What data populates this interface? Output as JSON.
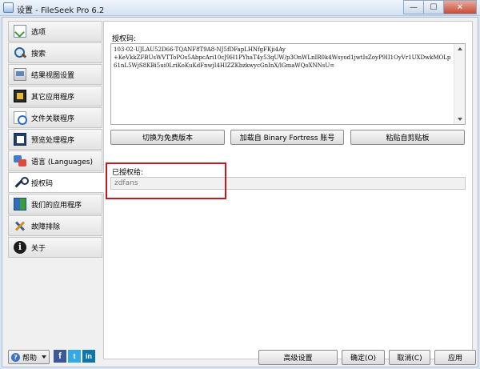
{
  "window": {
    "title": "设置 - FileSeek Pro 6.2",
    "min_glyph": "—",
    "max_glyph": "☐",
    "close_glyph": "✕"
  },
  "sidebar": {
    "items": [
      {
        "label": "选项",
        "icon": "options-icon",
        "active": false
      },
      {
        "label": "搜索",
        "icon": "search-icon",
        "active": false
      },
      {
        "label": "结果视图设置",
        "icon": "results-view-icon",
        "active": false
      },
      {
        "label": "其它应用程序",
        "icon": "other-apps-icon",
        "active": false
      },
      {
        "label": "文件关联程序",
        "icon": "file-association-icon",
        "active": false
      },
      {
        "label": "预览处理程序",
        "icon": "preview-handler-icon",
        "active": false
      },
      {
        "label": "语言 (Languages)",
        "icon": "language-icon",
        "active": false
      },
      {
        "label": "授权码",
        "icon": "key-icon",
        "active": true
      },
      {
        "label": "我们的应用程序",
        "icon": "our-apps-icon",
        "active": false
      },
      {
        "label": "故障排除",
        "icon": "troubleshooting-icon",
        "active": false
      },
      {
        "label": "关于",
        "icon": "about-icon",
        "active": false
      }
    ]
  },
  "license": {
    "key_label": "授权码:",
    "key_value": "103-02-UJLAU52D66-TQANF8T9A8-NJ5fDFapLHNfgFKji4Ay\n+KeVkkZFBUsWVTToPOs5AbpcAri10cJ9H1PYhaT4y53qUW/p3OnWLnIR0k4Wsyod1jwtIsZoyP9II1OyVr1UXDwkMOLp61nL5WjS8KBi5ui0LriKoKuKdFnwjI4HIZZKbzkwycGnInX/lGmaWQoXNNsU=",
    "btn_free": "切换为免费版本",
    "btn_bf": "加载自 Binary Fortress 账号",
    "btn_paste": "粘贴自剪贴板",
    "licensed_label": "已授权给:",
    "licensed_value": "zdfans",
    "highlight_color": "#c8181f"
  },
  "footer": {
    "help_label": "帮助",
    "social": [
      "facebook-icon",
      "twitter-icon",
      "linkedin-icon"
    ],
    "social_glyphs": {
      "facebook": "f",
      "twitter": "t",
      "linkedin": "in"
    },
    "advanced_label": "高级设置",
    "ok_label": "确定(O)",
    "cancel_label": "取消(C)",
    "apply_label": "应用"
  }
}
